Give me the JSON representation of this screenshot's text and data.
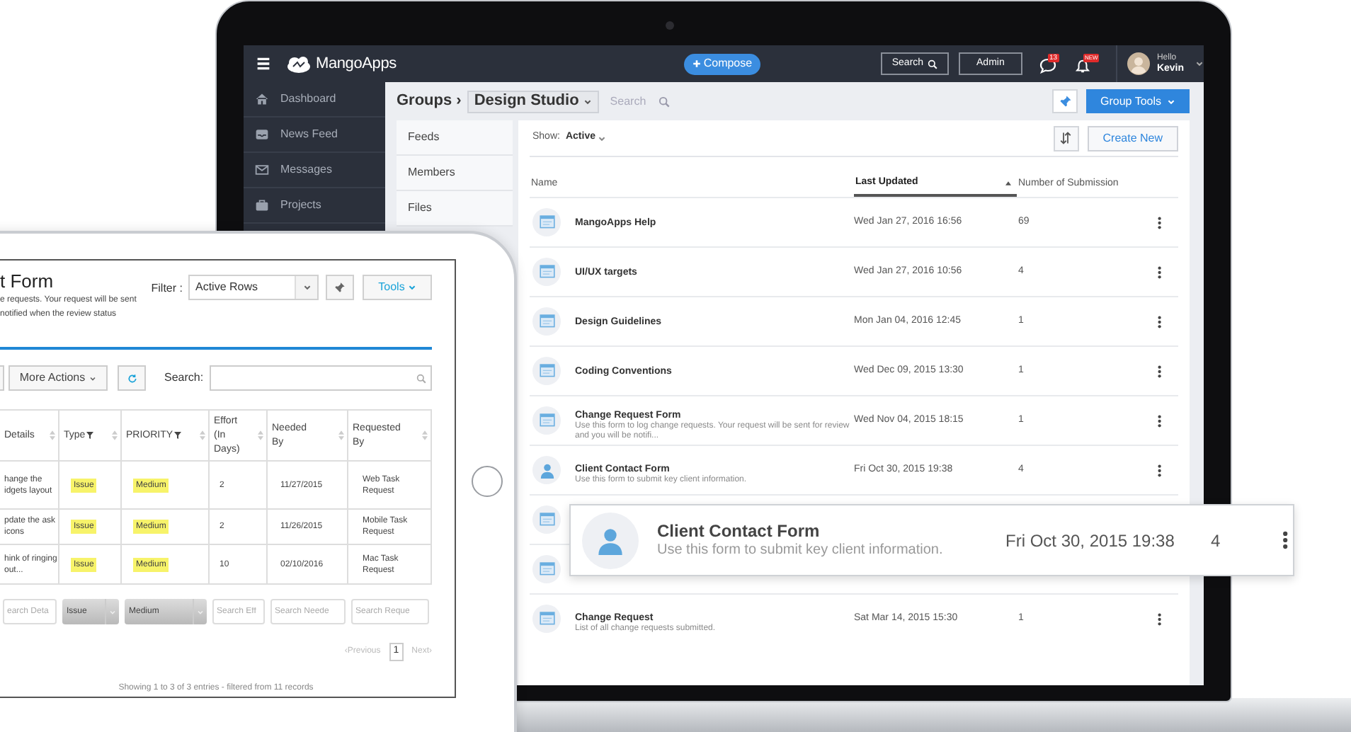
{
  "laptop": {
    "top_bar": {
      "logo": "MangoApps",
      "compose": "Compose",
      "search": "Search",
      "admin": "Admin",
      "chat_badge": "13",
      "alert_badge": "NEW",
      "greeting": "Hello",
      "user": "Kevin"
    },
    "sidebar": [
      {
        "label": "Dashboard",
        "kind": "home"
      },
      {
        "label": "News Feed",
        "kind": "inbox"
      },
      {
        "label": "Messages",
        "kind": "mail"
      },
      {
        "label": "Projects",
        "kind": "briefcase"
      }
    ],
    "header": {
      "section": "Groups ›",
      "group": "Design Studio",
      "search_placeholder": "Search",
      "tools": "Group Tools"
    },
    "subnav": [
      {
        "label": "Feeds"
      },
      {
        "label": "Members"
      },
      {
        "label": "Files"
      }
    ],
    "filter": {
      "label": "Show:",
      "value": "Active"
    },
    "create": "Create New",
    "columns": [
      {
        "label": "Name",
        "sorted": false
      },
      {
        "label": "Last Updated",
        "sorted": true
      },
      {
        "label": "Number of Submission",
        "sorted": false
      }
    ],
    "rows": [
      {
        "kind": "form",
        "name": "MangoApps Help",
        "updated": "Wed Jan 27, 2016 16:56",
        "count": "69"
      },
      {
        "kind": "form",
        "name": "UI/UX targets",
        "updated": "Wed Jan 27, 2016 10:56",
        "count": "4"
      },
      {
        "kind": "form",
        "name": "Design Guidelines",
        "updated": "Mon Jan 04, 2016 12:45",
        "count": "1"
      },
      {
        "kind": "form",
        "name": "Coding Conventions",
        "updated": "Wed Dec 09, 2015 13:30",
        "count": "1"
      },
      {
        "kind": "form",
        "name": "Change Request Form",
        "description": "Use this form to log change requests. Your request will be sent for review and you will be notifi...",
        "updated": "Wed Nov 04, 2015 18:15",
        "count": "1"
      },
      {
        "kind": "person",
        "name": "Client Contact Form",
        "description": "Use this form to submit key client information.",
        "updated": "Fri Oct 30, 2015 19:38",
        "count": "4"
      },
      {
        "kind": "form"
      },
      {
        "kind": "form"
      },
      {
        "kind": "form",
        "name": "Change Request",
        "description": "List of all change requests submitted.",
        "updated": "Sat Mar 14, 2015 15:30",
        "count": "1"
      }
    ]
  },
  "popup": {
    "kind": "person",
    "name": "Client Contact Form",
    "description": "Use this form to submit key client information.",
    "updated": "Fri Oct 30, 2015 19:38",
    "count": "4"
  },
  "tablet": {
    "title": "t Form",
    "description_lines": [
      "e requests. Your request will be sent",
      "notified when the review status"
    ],
    "filter": {
      "label": "Filter :",
      "value": "Active Rows"
    },
    "tools": "Tools",
    "more_actions": "More Actions",
    "search_label": "Search:",
    "columns": [
      {
        "label": "Details",
        "filterable": false
      },
      {
        "label": "Type",
        "filterable": true
      },
      {
        "label": "PRIORITY",
        "filterable": true
      },
      {
        "label": "Effort (In Days)",
        "filterable": false
      },
      {
        "label": "Needed By",
        "filterable": false
      },
      {
        "label": "Requested By",
        "filterable": false
      }
    ],
    "rows": [
      {
        "details": "hange the idgets layout",
        "type": "Issue",
        "priority": "Medium",
        "effort": "2",
        "needed_by": "11/27/2015",
        "requested_by": "Web Task Request"
      },
      {
        "details": "pdate the ask icons",
        "type": "Issue",
        "priority": "Medium",
        "effort": "2",
        "needed_by": "11/26/2015",
        "requested_by": "Mobile Task Request"
      },
      {
        "details": "hink of ringing out...",
        "type": "Issue",
        "priority": "Medium",
        "effort": "10",
        "needed_by": "02/10/2016",
        "requested_by": "Mac Task Request"
      }
    ],
    "column_filters": [
      {
        "kind": "text",
        "placeholder": "earch Deta"
      },
      {
        "kind": "select",
        "value": "Issue"
      },
      {
        "kind": "select",
        "value": "Medium"
      },
      {
        "kind": "text",
        "placeholder": "Search Eff"
      },
      {
        "kind": "text",
        "placeholder": "Search Neede"
      },
      {
        "kind": "text",
        "placeholder": "Search Reque"
      }
    ],
    "pagination": {
      "previous": "‹Previous",
      "pages": [
        {
          "label": "1",
          "selected": true
        }
      ],
      "next": "Next›"
    },
    "summary": "Showing 1 to 3 of 3 entries - filtered from 11 records"
  }
}
